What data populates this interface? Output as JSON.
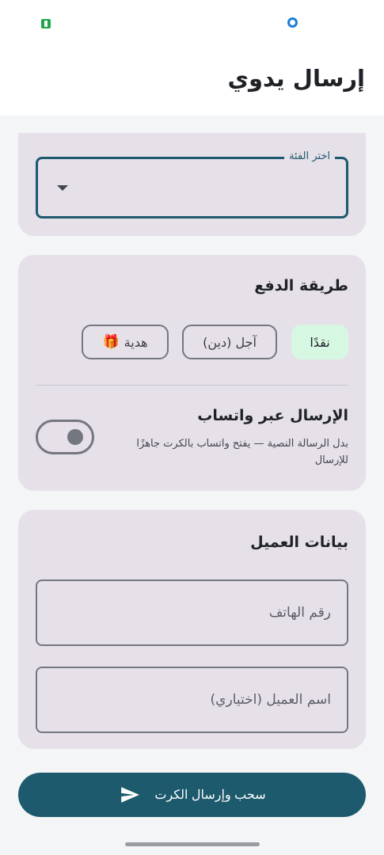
{
  "app_bar": {
    "title": "إرسال يدوي"
  },
  "category": {
    "label": "اختر الفئة",
    "value": ""
  },
  "payment": {
    "title": "طريقة الدفع",
    "options": [
      {
        "label": "نقدًا",
        "selected": true
      },
      {
        "label": "آجل (دين)",
        "selected": false
      },
      {
        "label": "هدية",
        "icon": "🎁",
        "selected": false
      }
    ]
  },
  "whatsapp": {
    "title": "الإرسال عبر واتساب",
    "description": "بدل الرسالة النصية — يفتح واتساب بالكرت جاهزًا للإرسال",
    "enabled": false
  },
  "customer": {
    "title": "بيانات العميل",
    "phone_placeholder": "رقم الهاتف",
    "name_placeholder": "اسم العميل (اختياري)"
  },
  "submit": {
    "label": "سحب وإرسال الكرت"
  },
  "colors": {
    "primary": "#1d5a6d",
    "card": "#e6e0e8",
    "selected_chip": "#d6f7e2",
    "background": "#f3f5f7"
  }
}
